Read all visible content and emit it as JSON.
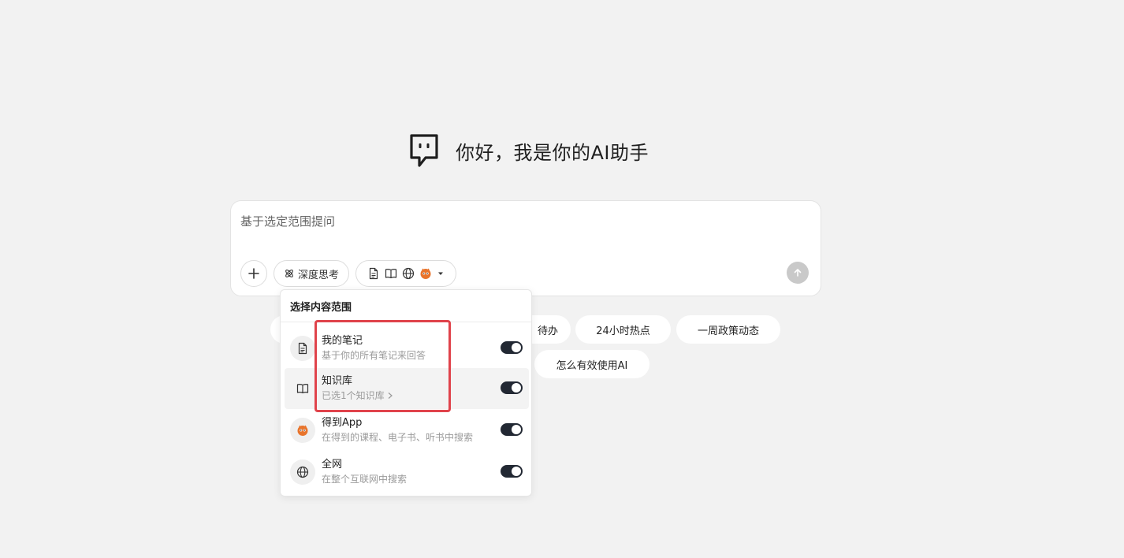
{
  "greeting": {
    "text": "你好，我是你的AI助手"
  },
  "prompt": {
    "placeholder": "基于选定范围提问",
    "deep_think_label": "深度思考",
    "add_icon": "plus-icon",
    "send_icon": "arrow-up-icon"
  },
  "suggestions": [
    {
      "label": "待办"
    },
    {
      "label": "24小时热点"
    },
    {
      "label": "一周政策动态"
    },
    {
      "label": "怎么有效使用AI"
    }
  ],
  "scope_menu": {
    "title": "选择内容范围",
    "items": [
      {
        "name": "我的笔记",
        "desc": "基于你的所有笔记来回答",
        "icon": "document-icon",
        "enabled": true
      },
      {
        "name": "知识库",
        "desc": "已选1个知识库",
        "icon": "book-icon",
        "enabled": true,
        "has_chevron": true
      },
      {
        "name": "得到App",
        "desc": "在得到的课程、电子书、听书中搜索",
        "icon": "dedao-logo-icon",
        "enabled": true
      },
      {
        "name": "全网",
        "desc": "在整个互联网中搜索",
        "icon": "globe-icon",
        "enabled": true
      }
    ]
  },
  "colors": {
    "background": "#f2f2f2",
    "toggle_on": "#222833",
    "highlight": "#e0434b",
    "brand_orange": "#e8742c"
  }
}
